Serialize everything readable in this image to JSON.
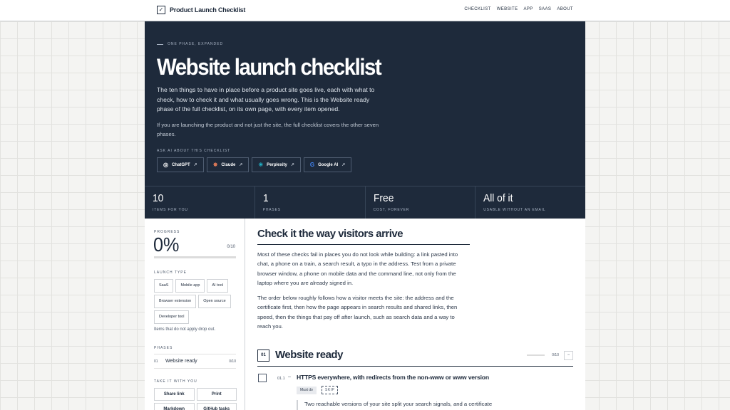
{
  "header": {
    "checkbox_glyph": "✓",
    "title": "Product Launch Checklist",
    "nav": [
      "CHECKLIST",
      "WEBSITE",
      "APP",
      "SAAS",
      "ABOUT"
    ]
  },
  "hero": {
    "eyebrow": "ONE PHASE, EXPANDED",
    "title": "Website launch checklist",
    "lead": "The ten things to have in place before a product site goes live, each with what to check, how to check it and what usually goes wrong. This is the Website ready phase of the full checklist, on its own page, with every item opened.",
    "sub": "If you are launching the product and not just the site, the full checklist covers the other seven phases.",
    "ask_label": "ASK AI ABOUT THIS CHECKLIST",
    "ai_buttons": [
      {
        "label": "ChatGPT",
        "icon": "chatgpt-icon",
        "glyph": "◎",
        "color": "#ffffff"
      },
      {
        "label": "Claude",
        "icon": "claude-icon",
        "glyph": "✸",
        "color": "#d97757"
      },
      {
        "label": "Perplexity",
        "icon": "perplexity-icon",
        "glyph": "✳",
        "color": "#20b8cd"
      },
      {
        "label": "Google AI",
        "icon": "google-icon",
        "glyph": "G",
        "color": "#4285f4"
      }
    ],
    "external_glyph": "↗"
  },
  "stats": [
    {
      "value": "10",
      "label": "ITEMS FOR YOU"
    },
    {
      "value": "1",
      "label": "PHASES"
    },
    {
      "value": "Free",
      "label": "COST, FOREVER"
    },
    {
      "value": "All of it",
      "label": "USABLE WITHOUT AN EMAIL"
    }
  ],
  "sidebar": {
    "progress_label": "PROGRESS",
    "progress_value": "0%",
    "progress_fraction": 0,
    "progress_count": "0/10",
    "launch_type_label": "LAUNCH TYPE",
    "launch_types": [
      "SaaS",
      "Mobile app",
      "AI tool",
      "Browser extension",
      "Open source",
      "Developer tool"
    ],
    "note": "Items that do not apply drop out.",
    "phases_label": "PHASES",
    "phases": [
      {
        "num": "01",
        "name": "Website ready",
        "count": "0/10"
      }
    ],
    "take_label": "TAKE IT WITH YOU",
    "take_buttons": [
      "Share link",
      "Print",
      "Markdown",
      "GitHub tasks"
    ]
  },
  "main": {
    "title": "Check it the way visitors arrive",
    "p1": "Most of these checks fail in places you do not look while building: a link pasted into chat, a phone on a train, a search result, a typo in the address. Test from a private browser window, a phone on mobile data and the command line, not only from the laptop where you are already signed in.",
    "p2": "The order below roughly follows how a visitor meets the site: the address and the certificate first, then how the page appears in search results and shared links, then speed, then the things that pay off after launch, such as search data and a way to reach you.",
    "phase": {
      "num": "01",
      "title": "Website ready",
      "count": "0/10",
      "toggle": "−"
    },
    "item": {
      "num": "01.1",
      "dash": "–",
      "title": "HTTPS everywhere, with redirects from the non-www or www version",
      "must": "Must do",
      "skip": "SKIP",
      "body": "Two reachable versions of your site split your search signals, and a certificate"
    }
  }
}
